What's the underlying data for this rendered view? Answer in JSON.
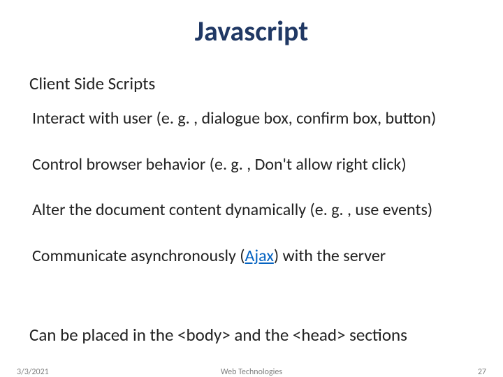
{
  "title": "Javascript",
  "subtitle": "Client Side Scripts",
  "bullets": [
    {
      "text": "Interact with user (e. g. , dialogue box, confirm box, button)"
    },
    {
      "text": "Control browser behavior (e. g. , Don't allow right click)"
    },
    {
      "text": "Alter the document content dynamically (e. g. , use events)"
    },
    {
      "prefix": "Communicate asynchronously (",
      "link": "Ajax",
      "suffix": ") with the server"
    }
  ],
  "placement": "Can be placed in the <body> and the <head> sections",
  "footer": {
    "date": "3/3/2021",
    "center": "Web Technologies",
    "pagenum": "27"
  }
}
